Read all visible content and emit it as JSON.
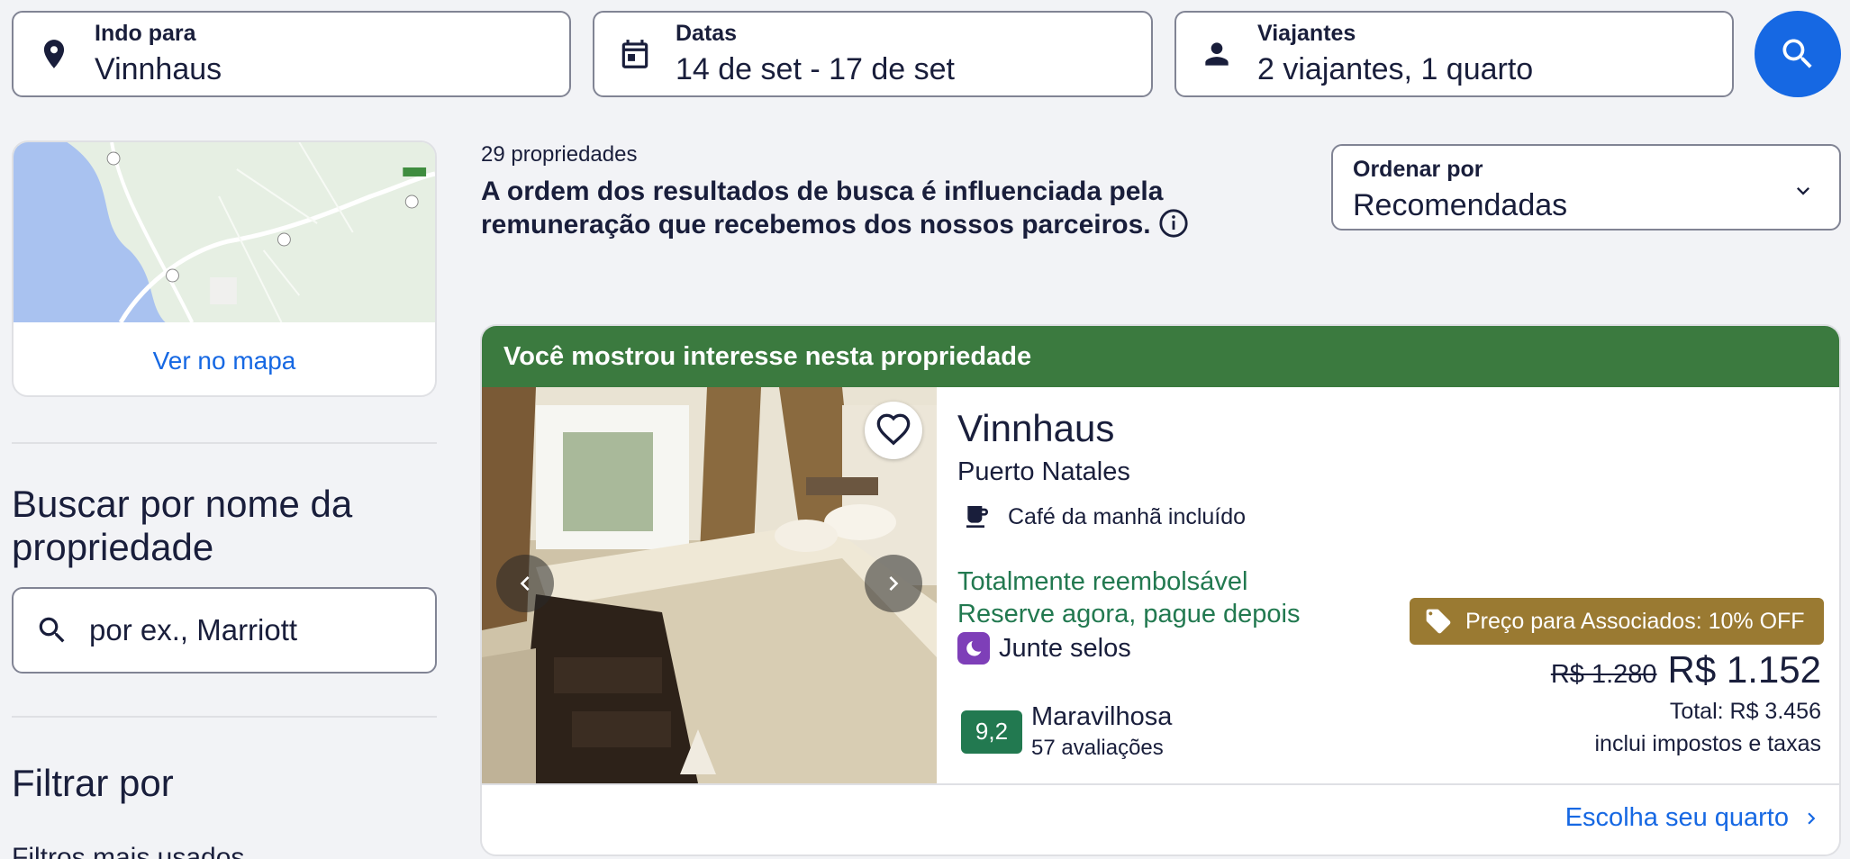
{
  "search": {
    "destination": {
      "label": "Indo para",
      "value": "Vinnhaus",
      "icon": "location-pin-icon"
    },
    "dates": {
      "label": "Datas",
      "value": "14 de set - 17 de set",
      "icon": "calendar-icon"
    },
    "travelers": {
      "label": "Viajantes",
      "value": "2 viajantes, 1 quarto",
      "icon": "person-icon"
    },
    "search_button_icon": "search-icon"
  },
  "sidebar": {
    "map_link": "Ver no mapa",
    "search_by_name_heading": "Buscar por nome da propriedade",
    "name_input_placeholder": "por ex., Marriott",
    "filter_heading": "Filtrar por",
    "filter_subheading": "Filtros mais usados"
  },
  "results": {
    "count": "29 propriedades",
    "disclaimer": "A ordem dos resultados de busca é influenciada pela remuneração que recebemos dos nossos parceiros.",
    "sort": {
      "label": "Ordenar por",
      "value": "Recomendadas"
    }
  },
  "property": {
    "banner": "Você mostrou interesse nesta propriedade",
    "name": "Vinnhaus",
    "location": "Puerto Natales",
    "amenity": "Café da manhã incluído",
    "refund_line1": "Totalmente reembolsável",
    "refund_line2": "Reserve agora, pague depois",
    "stamps": "Junte selos",
    "rating_score": "9,2",
    "rating_word": "Maravilhosa",
    "review_count": "57 avaliações",
    "promo": "Preço para Associados: 10% OFF",
    "old_price": "R$ 1.280",
    "new_price": "R$ 1.152",
    "total": "Total: R$ 3.456",
    "taxes_note": "inclui impostos e taxas",
    "cta": "Escolha seu quarto"
  },
  "colors": {
    "brand_blue": "#1668e3",
    "banner_green": "#3b7a3f",
    "rating_green": "#227950",
    "promo_gold": "#9a7a32",
    "stamp_purple": "#7e3fb8"
  }
}
